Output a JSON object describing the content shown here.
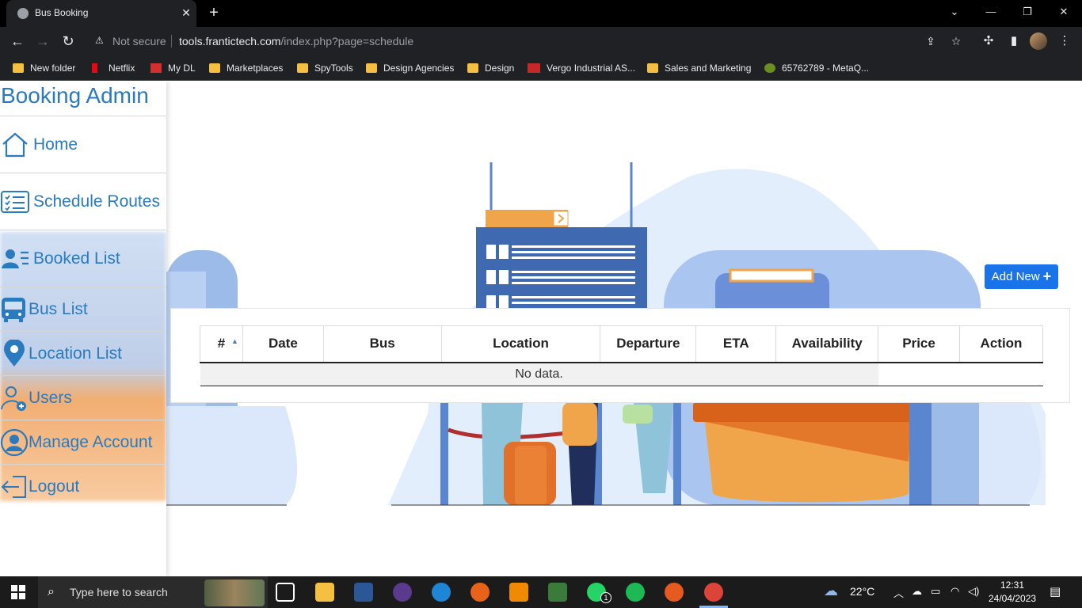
{
  "browser": {
    "tab_title": "Bus Booking",
    "url_prefix": "Not secure",
    "url_host": "tools.frantictech.com",
    "url_path": "/index.php?page=schedule",
    "bookmarks": [
      {
        "label": "New folder",
        "icon": "folder-icon"
      },
      {
        "label": "Netflix",
        "icon": "netflix-icon"
      },
      {
        "label": "My DL",
        "icon": "mydl-icon"
      },
      {
        "label": "Marketplaces",
        "icon": "folder-icon"
      },
      {
        "label": "SpyTools",
        "icon": "folder-icon"
      },
      {
        "label": "Design Agencies",
        "icon": "folder-icon"
      },
      {
        "label": "Design",
        "icon": "folder-icon"
      },
      {
        "label": "Vergo Industrial AS...",
        "icon": "vergo-icon"
      },
      {
        "label": "Sales and Marketing",
        "icon": "folder-icon"
      },
      {
        "label": "65762789 - MetaQ...",
        "icon": "metaq-icon"
      }
    ]
  },
  "app": {
    "brand": "Booking Admin",
    "nav": [
      {
        "label": "Home",
        "icon": "home-icon"
      },
      {
        "label": "Schedule Routes",
        "icon": "schedule-list-icon"
      },
      {
        "label": "Booked List",
        "icon": "booked-users-icon"
      },
      {
        "label": "Bus List",
        "icon": "bus-icon"
      },
      {
        "label": "Location List",
        "icon": "location-pin-icon"
      },
      {
        "label": "Users",
        "icon": "add-user-icon"
      },
      {
        "label": "Manage Account",
        "icon": "account-icon"
      },
      {
        "label": "Logout",
        "icon": "logout-icon"
      }
    ],
    "add_new_label": "Add New",
    "table": {
      "columns": [
        "#",
        "Date",
        "Bus",
        "Location",
        "Departure",
        "ETA",
        "Availability",
        "Price",
        "Action"
      ],
      "empty_text": "No data."
    }
  },
  "taskbar": {
    "search_placeholder": "Type here to search",
    "weather": "22°C",
    "time": "12:31",
    "date": "24/04/2023",
    "whatsapp_badge": "1"
  },
  "colors": {
    "brand": "#2a7ac0",
    "button": "#1a73e8"
  }
}
